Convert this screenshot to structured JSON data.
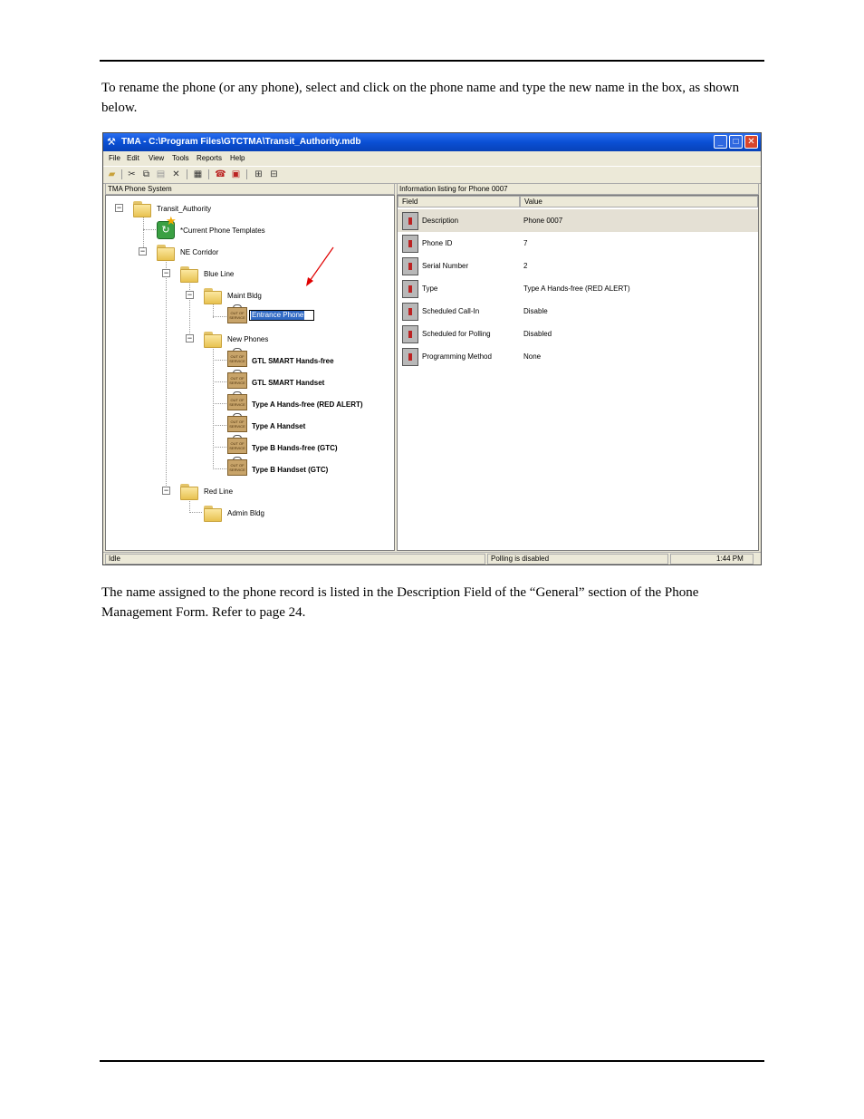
{
  "document": {
    "intro_text": "To rename the phone (or any phone), select and click on the phone name and type the new name in the box, as shown below.",
    "outro_text": "The name assigned to the phone record is listed in the Description Field of the “General” section of the Phone Management Form.  Refer to page 24."
  },
  "window": {
    "title": "TMA - C:\\Program Files\\GTCTMA\\Transit_Authority.mdb",
    "controls": {
      "minimize": "_",
      "maximize": "□",
      "close": "✕"
    }
  },
  "menu": [
    "File",
    "Edit",
    "View",
    "Tools",
    "Reports",
    "Help"
  ],
  "toolbar_icons": [
    "open-folder-icon",
    "cut-icon",
    "copy-icon",
    "paste-icon",
    "delete-icon",
    "properties-icon",
    "poll-icon",
    "alert-icon",
    "tree-expand-icon",
    "tree-collapse-icon"
  ],
  "left_pane": {
    "header": "TMA Phone System",
    "tree": {
      "root": "Transit_Authority",
      "templates": "*Current Phone Templates",
      "corridor": "NE Corridor",
      "blue_line": "Blue Line",
      "maint_bldg": "Maint Bldg",
      "edit_value": "Entrance Phone",
      "new_phones": "New Phones",
      "phones": [
        "GTL SMART Hands-free",
        "GTL SMART Handset",
        "Type A Hands-free (RED ALERT)",
        "Type A Handset",
        "Type B Hands-free (GTC)",
        "Type B Handset (GTC)"
      ],
      "red_line": "Red Line",
      "admin_bldg": "Admin Bldg",
      "oos_sign": "OUT OF SERVICE"
    }
  },
  "right_pane": {
    "header": "Information listing for Phone 0007",
    "columns": [
      "Field",
      "Value"
    ],
    "rows": [
      {
        "field": "Description",
        "value": "Phone 0007"
      },
      {
        "field": "Phone ID",
        "value": "7"
      },
      {
        "field": "Serial Number",
        "value": "2"
      },
      {
        "field": "Type",
        "value": "Type A Hands-free (RED ALERT)"
      },
      {
        "field": "Scheduled Call-In",
        "value": "Disable"
      },
      {
        "field": "Scheduled for Polling",
        "value": "Disabled"
      },
      {
        "field": "Programming Method",
        "value": "None"
      }
    ]
  },
  "status_bar": {
    "state": "Idle",
    "polling": "Polling is disabled",
    "time": "1:44 PM"
  },
  "colors": {
    "title_bar": "#0a4fd4",
    "selection": "#316ac5",
    "arrow": "#e00000"
  }
}
